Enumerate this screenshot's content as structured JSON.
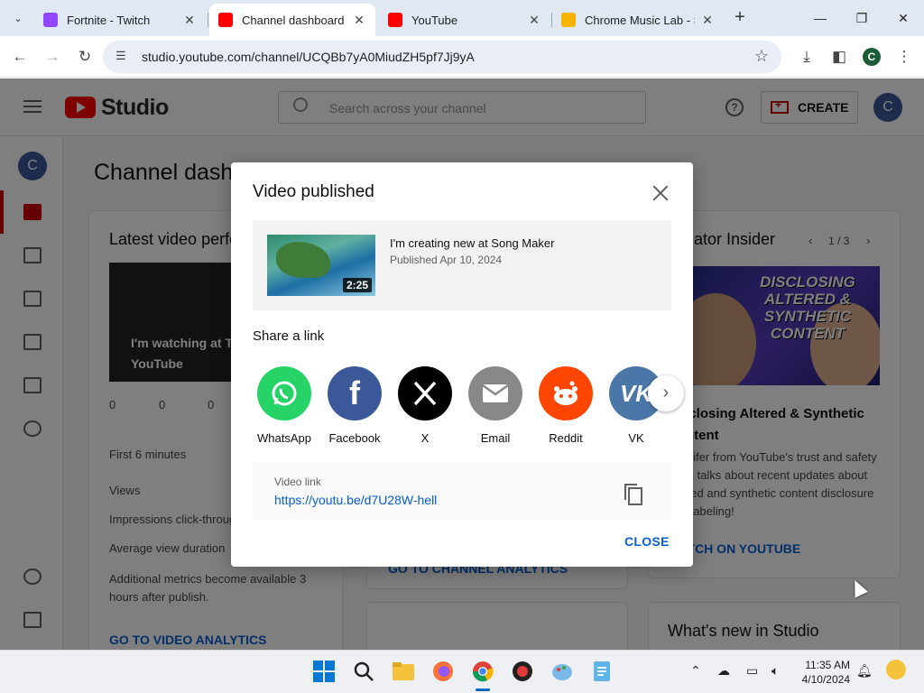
{
  "browser": {
    "tabs": [
      {
        "title": "Fortnite - Twitch",
        "favicon_color": "#9146ff"
      },
      {
        "title": "Channel dashboard - YouTube Studio",
        "favicon_color": "#ff0000",
        "active": true
      },
      {
        "title": "YouTube",
        "favicon_color": "#ff0000"
      },
      {
        "title": "Chrome Music Lab - Song Maker",
        "favicon_color": "#f4b400"
      }
    ],
    "url": "studio.youtube.com/channel/UCQBb7yA0MiudZH5pf7Jj9yA",
    "profile_initial": "C"
  },
  "studio": {
    "logo_text": "Studio",
    "search_placeholder": "Search across your channel",
    "create_label": "CREATE",
    "avatar_initial": "C",
    "page_title": "Channel dashboard",
    "latest_video": {
      "heading": "Latest video performance",
      "thumb_text": "I'm watching at T YouTube",
      "stats": [
        "0",
        "0",
        "0"
      ],
      "first_period": "First 6 minutes",
      "rows": [
        "Views",
        "Impressions click-through rate",
        "Average view duration"
      ],
      "note": "Additional metrics become available 3 hours after publish.",
      "link": "GO TO VIDEO ANALYTICS"
    },
    "analytics_link": "GO TO CHANNEL ANALYTICS",
    "insider": {
      "heading": "Creator Insider",
      "pager": "1 / 3",
      "image_text": "DISCLOSING ALTERED & SYNTHETIC CONTENT",
      "title": "Disclosing Altered & Synthetic Content",
      "desc": "Jennifer from YouTube's trust and safety team talks about recent updates about altered and synthetic content disclosure and labeling!",
      "link": "WATCH ON YOUTUBE"
    },
    "whats_new": "What's new in Studio"
  },
  "dialog": {
    "title": "Video published",
    "video": {
      "title": "I'm creating new at Song Maker",
      "published": "Published Apr 10, 2024",
      "duration": "2:25"
    },
    "share_heading": "Share a link",
    "share_targets": [
      {
        "label": "WhatsApp",
        "color": "#25d366",
        "icon": "whatsapp-icon"
      },
      {
        "label": "Facebook",
        "color": "#3b5998",
        "icon": "facebook-icon"
      },
      {
        "label": "X",
        "color": "#000000",
        "icon": "x-icon"
      },
      {
        "label": "Email",
        "color": "#888888",
        "icon": "email-icon"
      },
      {
        "label": "Reddit",
        "color": "#ff4500",
        "icon": "reddit-icon"
      },
      {
        "label": "VK",
        "color": "#4a76a8",
        "icon": "vk-icon"
      }
    ],
    "link_label": "Video link",
    "link_url": "https://youtu.be/d7U28W-hell",
    "close_label": "CLOSE"
  },
  "taskbar": {
    "time": "11:35 AM",
    "date": "4/10/2024"
  }
}
